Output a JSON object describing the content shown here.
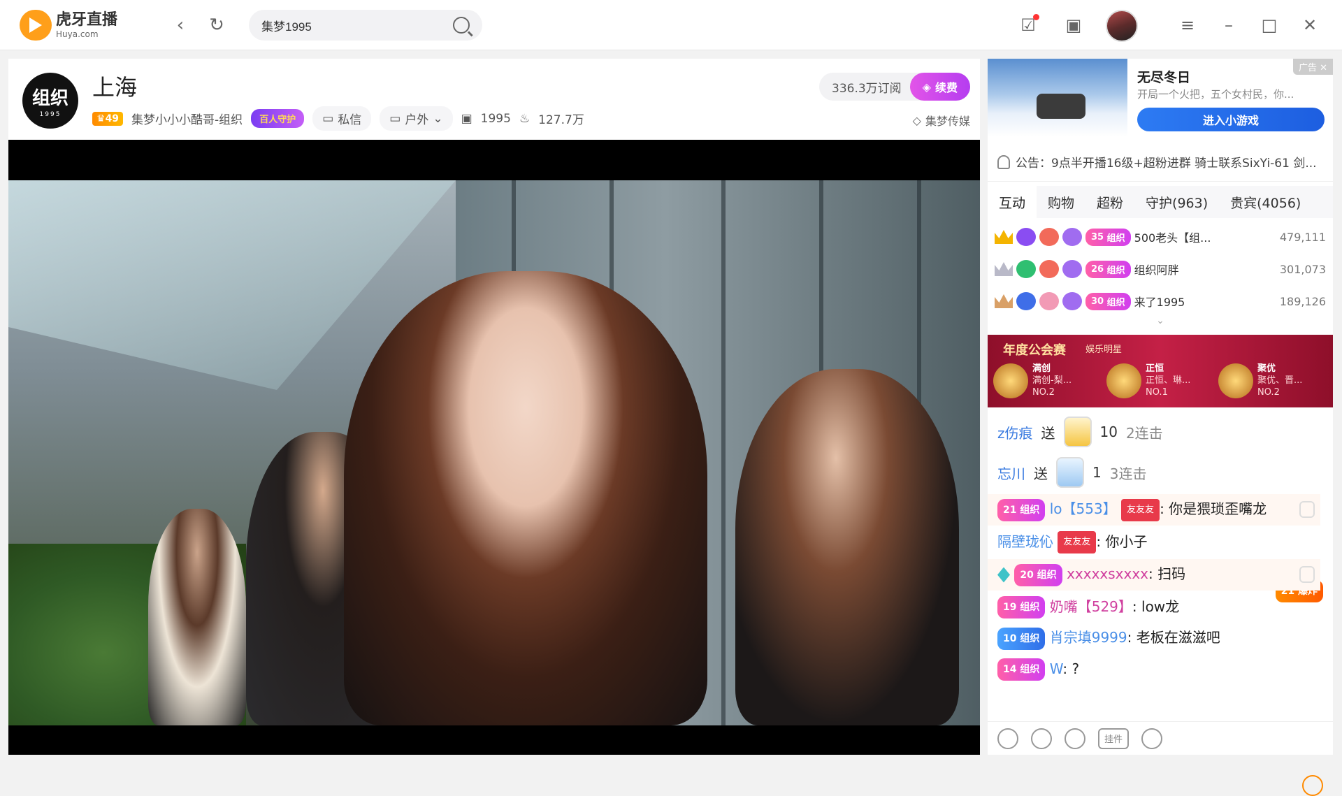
{
  "app": {
    "logo_cn": "虎牙直播",
    "logo_en": "Huya.com"
  },
  "search": {
    "value": "集梦1995"
  },
  "room": {
    "title": "上海",
    "level": "49",
    "streamer": "集梦小小小酷哥-组织",
    "guard_badge": "百人守护",
    "private_msg": "私信",
    "category": "户外",
    "room_id": "1995",
    "heat": "127.7万",
    "subscribers": "336.3万订阅",
    "renew": "续费",
    "org": "集梦传媒",
    "avatar_text": "组织",
    "avatar_num": "1995"
  },
  "ad": {
    "tag": "广告",
    "title": "无尽冬日",
    "desc": "开局一个火把，五个女村民，你...",
    "button": "进入小游戏"
  },
  "notice": "公告：9点半开播16级+超粉进群 骑士联系SixYi-61 剑...",
  "tabs": [
    "互动",
    "购物",
    "超粉",
    "守护(963)",
    "贵宾(4056)"
  ],
  "rank": [
    {
      "lvl": "35",
      "fan": "组织",
      "name": "500老头【组...",
      "score": "479,111",
      "crown": "#f4b400"
    },
    {
      "lvl": "26",
      "fan": "组织",
      "name": "组织阿胖",
      "score": "301,073",
      "crown": "#b9b9c8"
    },
    {
      "lvl": "30",
      "fan": "组织",
      "name": "来了1995",
      "score": "189,126",
      "crown": "#d9a066"
    }
  ],
  "banner": {
    "title": "年度公会赛",
    "sub": "娱乐明星",
    "items": [
      {
        "name": "满创",
        "sub": "满创-梨...",
        "rank": "NO.2"
      },
      {
        "name": "正恒",
        "sub": "正恒、琳...",
        "rank": "NO.1"
      },
      {
        "name": "聚优",
        "sub": "聚优、晋...",
        "rank": "NO.2"
      }
    ]
  },
  "gifts": [
    {
      "user": "z伤痕",
      "send": "送",
      "count": "10",
      "combo": "2连击"
    },
    {
      "user": "忘川",
      "send": "送",
      "count": "1",
      "combo": "3连击"
    }
  ],
  "messages": [
    {
      "lvl": "21",
      "fan": "组织",
      "user": "lo【553】",
      "tag": "友友友",
      "text": "你是猥琐歪嘴龙"
    },
    {
      "lvl": "21",
      "fan": "爆炸",
      "user": "隔壁珑伈",
      "tag": "友友友",
      "text": "你小子"
    },
    {
      "lvl": "20",
      "fan": "组织",
      "user": "xxxxxsxxxx",
      "text": "扫码"
    },
    {
      "lvl": "19",
      "fan": "组织",
      "user": "奶嘴【529】",
      "text": "low龙"
    },
    {
      "lvl": "10",
      "fan": "组织",
      "user": "肖宗填9999",
      "text": "老板在滋滋吧"
    },
    {
      "lvl": "14",
      "fan": "组织",
      "user": "W",
      "text": "?"
    }
  ],
  "tools": {
    "hang": "挂件"
  }
}
